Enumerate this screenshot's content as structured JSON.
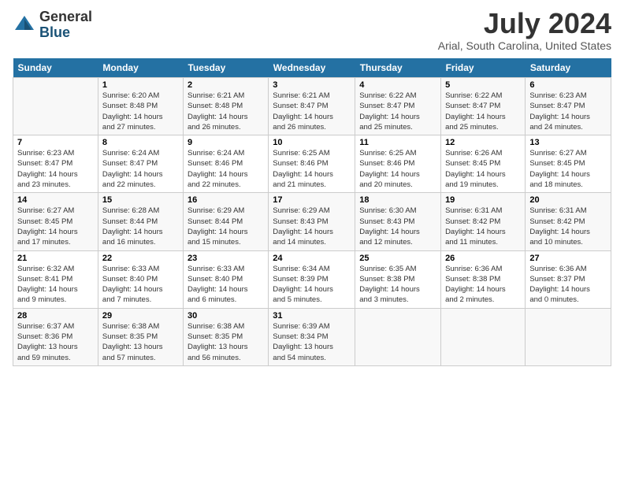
{
  "logo": {
    "general": "General",
    "blue": "Blue"
  },
  "title": "July 2024",
  "subtitle": "Arial, South Carolina, United States",
  "header_days": [
    "Sunday",
    "Monday",
    "Tuesday",
    "Wednesday",
    "Thursday",
    "Friday",
    "Saturday"
  ],
  "weeks": [
    [
      {
        "day": "",
        "info": ""
      },
      {
        "day": "1",
        "info": "Sunrise: 6:20 AM\nSunset: 8:48 PM\nDaylight: 14 hours\nand 27 minutes."
      },
      {
        "day": "2",
        "info": "Sunrise: 6:21 AM\nSunset: 8:48 PM\nDaylight: 14 hours\nand 26 minutes."
      },
      {
        "day": "3",
        "info": "Sunrise: 6:21 AM\nSunset: 8:47 PM\nDaylight: 14 hours\nand 26 minutes."
      },
      {
        "day": "4",
        "info": "Sunrise: 6:22 AM\nSunset: 8:47 PM\nDaylight: 14 hours\nand 25 minutes."
      },
      {
        "day": "5",
        "info": "Sunrise: 6:22 AM\nSunset: 8:47 PM\nDaylight: 14 hours\nand 25 minutes."
      },
      {
        "day": "6",
        "info": "Sunrise: 6:23 AM\nSunset: 8:47 PM\nDaylight: 14 hours\nand 24 minutes."
      }
    ],
    [
      {
        "day": "7",
        "info": "Sunrise: 6:23 AM\nSunset: 8:47 PM\nDaylight: 14 hours\nand 23 minutes."
      },
      {
        "day": "8",
        "info": "Sunrise: 6:24 AM\nSunset: 8:47 PM\nDaylight: 14 hours\nand 22 minutes."
      },
      {
        "day": "9",
        "info": "Sunrise: 6:24 AM\nSunset: 8:46 PM\nDaylight: 14 hours\nand 22 minutes."
      },
      {
        "day": "10",
        "info": "Sunrise: 6:25 AM\nSunset: 8:46 PM\nDaylight: 14 hours\nand 21 minutes."
      },
      {
        "day": "11",
        "info": "Sunrise: 6:25 AM\nSunset: 8:46 PM\nDaylight: 14 hours\nand 20 minutes."
      },
      {
        "day": "12",
        "info": "Sunrise: 6:26 AM\nSunset: 8:45 PM\nDaylight: 14 hours\nand 19 minutes."
      },
      {
        "day": "13",
        "info": "Sunrise: 6:27 AM\nSunset: 8:45 PM\nDaylight: 14 hours\nand 18 minutes."
      }
    ],
    [
      {
        "day": "14",
        "info": "Sunrise: 6:27 AM\nSunset: 8:45 PM\nDaylight: 14 hours\nand 17 minutes."
      },
      {
        "day": "15",
        "info": "Sunrise: 6:28 AM\nSunset: 8:44 PM\nDaylight: 14 hours\nand 16 minutes."
      },
      {
        "day": "16",
        "info": "Sunrise: 6:29 AM\nSunset: 8:44 PM\nDaylight: 14 hours\nand 15 minutes."
      },
      {
        "day": "17",
        "info": "Sunrise: 6:29 AM\nSunset: 8:43 PM\nDaylight: 14 hours\nand 14 minutes."
      },
      {
        "day": "18",
        "info": "Sunrise: 6:30 AM\nSunset: 8:43 PM\nDaylight: 14 hours\nand 12 minutes."
      },
      {
        "day": "19",
        "info": "Sunrise: 6:31 AM\nSunset: 8:42 PM\nDaylight: 14 hours\nand 11 minutes."
      },
      {
        "day": "20",
        "info": "Sunrise: 6:31 AM\nSunset: 8:42 PM\nDaylight: 14 hours\nand 10 minutes."
      }
    ],
    [
      {
        "day": "21",
        "info": "Sunrise: 6:32 AM\nSunset: 8:41 PM\nDaylight: 14 hours\nand 9 minutes."
      },
      {
        "day": "22",
        "info": "Sunrise: 6:33 AM\nSunset: 8:40 PM\nDaylight: 14 hours\nand 7 minutes."
      },
      {
        "day": "23",
        "info": "Sunrise: 6:33 AM\nSunset: 8:40 PM\nDaylight: 14 hours\nand 6 minutes."
      },
      {
        "day": "24",
        "info": "Sunrise: 6:34 AM\nSunset: 8:39 PM\nDaylight: 14 hours\nand 5 minutes."
      },
      {
        "day": "25",
        "info": "Sunrise: 6:35 AM\nSunset: 8:38 PM\nDaylight: 14 hours\nand 3 minutes."
      },
      {
        "day": "26",
        "info": "Sunrise: 6:36 AM\nSunset: 8:38 PM\nDaylight: 14 hours\nand 2 minutes."
      },
      {
        "day": "27",
        "info": "Sunrise: 6:36 AM\nSunset: 8:37 PM\nDaylight: 14 hours\nand 0 minutes."
      }
    ],
    [
      {
        "day": "28",
        "info": "Sunrise: 6:37 AM\nSunset: 8:36 PM\nDaylight: 13 hours\nand 59 minutes."
      },
      {
        "day": "29",
        "info": "Sunrise: 6:38 AM\nSunset: 8:35 PM\nDaylight: 13 hours\nand 57 minutes."
      },
      {
        "day": "30",
        "info": "Sunrise: 6:38 AM\nSunset: 8:35 PM\nDaylight: 13 hours\nand 56 minutes."
      },
      {
        "day": "31",
        "info": "Sunrise: 6:39 AM\nSunset: 8:34 PM\nDaylight: 13 hours\nand 54 minutes."
      },
      {
        "day": "",
        "info": ""
      },
      {
        "day": "",
        "info": ""
      },
      {
        "day": "",
        "info": ""
      }
    ]
  ]
}
